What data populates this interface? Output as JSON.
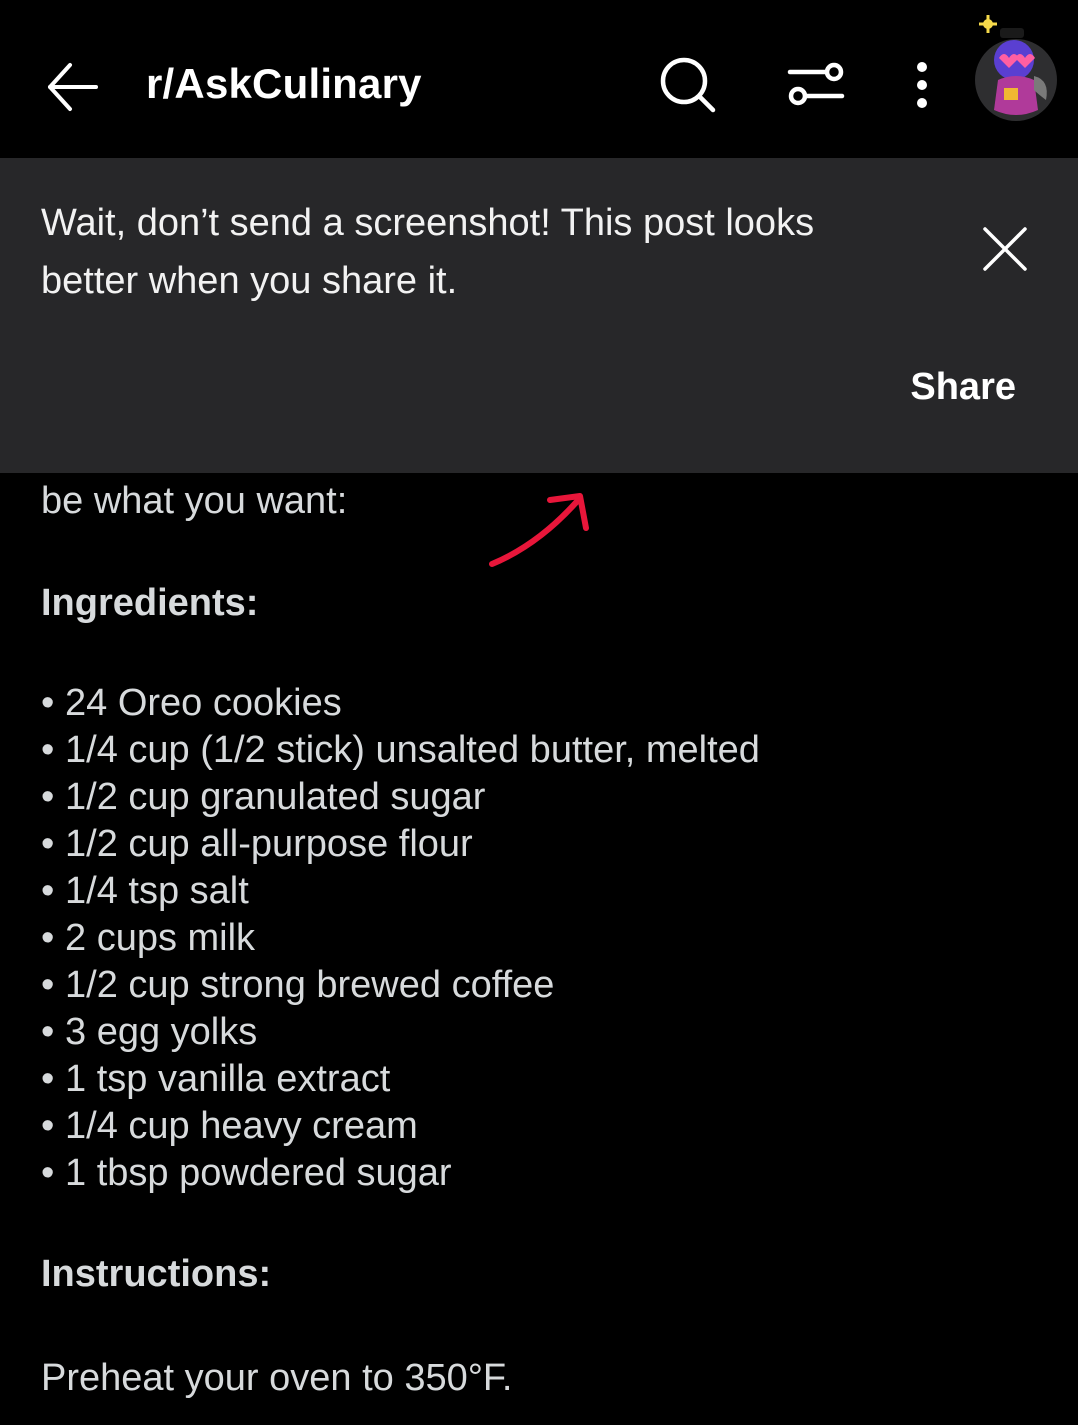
{
  "app_bar": {
    "title": "r/AskCulinary",
    "back_icon": "arrow-left-icon",
    "search_icon": "search-icon",
    "filter_icon": "sliders-icon",
    "more_icon": "more-vertical-icon",
    "avatar_icon": "user-avatar"
  },
  "banner": {
    "message": "Wait, don’t send a screenshot! This post looks better when you share it.",
    "share_label": "Share",
    "close_icon": "close-icon",
    "background": "#272729"
  },
  "post": {
    "partial_line": "be what you want:",
    "ingredients_heading": "Ingredients:",
    "ingredients": [
      "24 Oreo cookies",
      "1/4 cup (1/2 stick) unsalted butter, melted",
      "1/2 cup granulated sugar",
      "1/2 cup all-purpose flour",
      "1/4 tsp salt",
      "2 cups milk",
      "1/2 cup strong brewed coffee",
      "3 egg yolks",
      "1 tsp vanilla extract",
      "1/4 cup heavy cream",
      "1 tbsp powdered sugar"
    ],
    "instructions_heading": "Instructions:",
    "first_instruction": "Preheat your oven to 350°F."
  },
  "annotation": {
    "arrow_color": "#e8163a"
  }
}
